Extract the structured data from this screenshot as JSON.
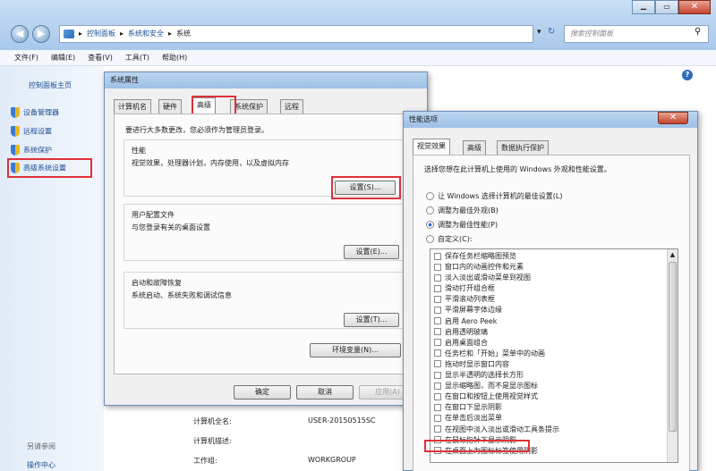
{
  "explorer": {
    "breadcrumb": [
      "控制面板",
      "系统和安全",
      "系统"
    ],
    "search_placeholder": "搜索控制面板",
    "menu": [
      "文件(F)",
      "编辑(E)",
      "查看(V)",
      "工具(T)",
      "帮助(H)"
    ],
    "sidebar": {
      "home": "控制面板主页",
      "items": [
        "设备管理器",
        "远程设置",
        "系统保护",
        "高级系统设置"
      ],
      "see_also": "另请参阅",
      "bottom_link": "操作中心"
    },
    "info": {
      "computer_full_name_label": "计算机全名:",
      "computer_full_name": "USER-20150515SC",
      "description_label": "计算机描述:",
      "workgroup_label": "工作组:",
      "workgroup": "WORKGROUP"
    }
  },
  "sysprops": {
    "title": "系统属性",
    "tabs": [
      "计算机名",
      "硬件",
      "高级",
      "系统保护",
      "远程"
    ],
    "admin_note": "要进行大多数更改，您必须作为管理员登录。",
    "perf_title": "性能",
    "perf_desc": "视觉效果，处理器计划，内存使用，以及虚拟内存",
    "settings_btn": "设置(S)...",
    "profile_title": "用户配置文件",
    "profile_desc": "与您登录有关的桌面设置",
    "settings_e_btn": "设置(E)...",
    "startup_title": "启动和故障恢复",
    "startup_desc": "系统启动、系统失败和调试信息",
    "settings_t_btn": "设置(T)...",
    "env_btn": "环境变量(N)...",
    "ok": "确定",
    "cancel": "取消",
    "apply": "应用(A)"
  },
  "perfopts": {
    "title": "性能选项",
    "tabs": [
      "视觉效果",
      "高级",
      "数据执行保护"
    ],
    "intro": "选择您想在此计算机上使用的 Windows 外观和性能设置。",
    "radios": [
      "让 Windows 选择计算机的最佳设置(L)",
      "调整为最佳外观(B)",
      "调整为最佳性能(P)",
      "自定义(C):"
    ],
    "checks": [
      "保存任务栏缩略图预览",
      "窗口内的动画控件和元素",
      "淡入淡出或滑动菜单到视图",
      "滑动打开组合框",
      "平滑滚动列表框",
      "平滑屏幕字体边缘",
      "启用 Aero Peek",
      "启用透明玻璃",
      "启用桌面组合",
      "任务栏和「开始」菜单中的动画",
      "拖动时显示窗口内容",
      "显示半透明的选择长方形",
      "显示缩略图，而不是显示图标",
      "在窗口和按钮上使用视觉样式",
      "在窗口下显示阴影",
      "在单击后淡出菜单",
      "在视图中淡入淡出或滑动工具条提示",
      "在鼠标指针下显示阴影",
      "在桌面上为图标标签使用阴影"
    ]
  }
}
